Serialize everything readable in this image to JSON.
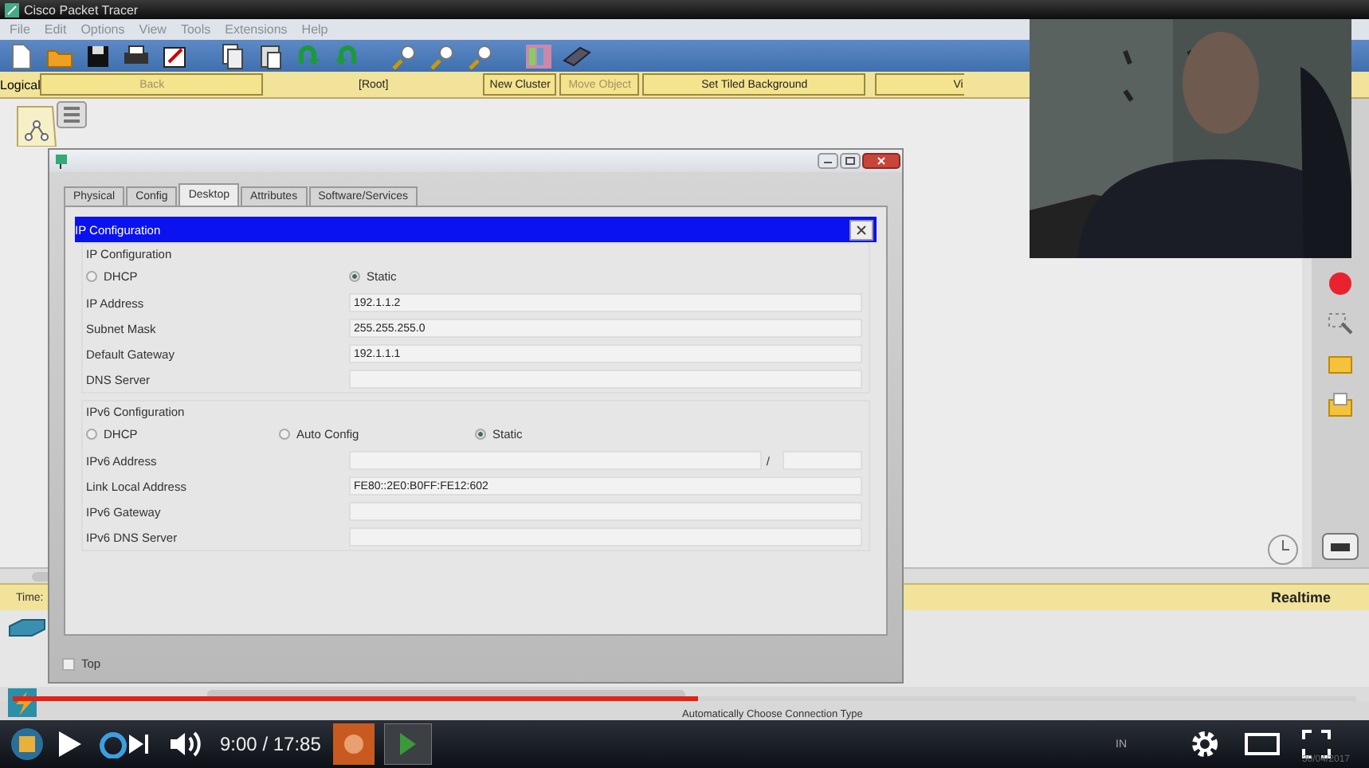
{
  "app": {
    "title": "Cisco Packet Tracer",
    "menu": [
      "File",
      "Edit",
      "Options",
      "View",
      "Tools",
      "Extensions",
      "Help"
    ],
    "workspace_bar": {
      "mode": "Logical",
      "buttons": [
        {
          "label": "Back",
          "disabled": true
        },
        {
          "label": "[Root]",
          "disabled": false
        },
        {
          "label": "New Cluster",
          "disabled": false
        },
        {
          "label": "Move Object",
          "disabled": true
        },
        {
          "label": "Set Tiled Background",
          "disabled": false
        },
        {
          "label": "Vi",
          "disabled": false
        }
      ]
    },
    "time_bar": {
      "label": "Time:",
      "mode": "Realtime"
    },
    "status_bar": "Automatically Choose Connection Type"
  },
  "dialog": {
    "tabs": [
      {
        "label": "Physical",
        "selected": false
      },
      {
        "label": "Config",
        "selected": false
      },
      {
        "label": "Desktop",
        "selected": true
      },
      {
        "label": "Attributes",
        "selected": false
      },
      {
        "label": "Software/Services",
        "selected": false
      }
    ],
    "panel_title": "IP Configuration",
    "ipv4": {
      "heading": "IP Configuration",
      "modes": [
        {
          "label": "DHCP",
          "selected": false
        },
        {
          "label": "Static",
          "selected": true
        }
      ],
      "fields": [
        {
          "label": "IP Address",
          "value": "192.1.1.2"
        },
        {
          "label": "Subnet Mask",
          "value": "255.255.255.0"
        },
        {
          "label": "Default Gateway",
          "value": "192.1.1.1"
        },
        {
          "label": "DNS Server"
        }
      ]
    },
    "ipv6": {
      "heading": "IPv6 Configuration",
      "modes": [
        {
          "label": "DHCP",
          "selected": false
        },
        {
          "label": "Auto Config",
          "selected": false
        },
        {
          "label": "Static",
          "selected": true
        }
      ],
      "fields": [
        {
          "label": "IPv6 Address",
          "separator": "/"
        },
        {
          "label": "Link Local Address",
          "value": "FE80::2E0:B0FF:FE12:602"
        },
        {
          "label": "IPv6 Gateway"
        },
        {
          "label": "IPv6 DNS Server"
        }
      ]
    },
    "top_checkbox": {
      "label": "Top",
      "checked": false
    }
  },
  "video": {
    "time": "9:00 / 17:85",
    "level": 0.51,
    "taskbar": {
      "language": "IN",
      "date": "30/04/2017"
    }
  }
}
